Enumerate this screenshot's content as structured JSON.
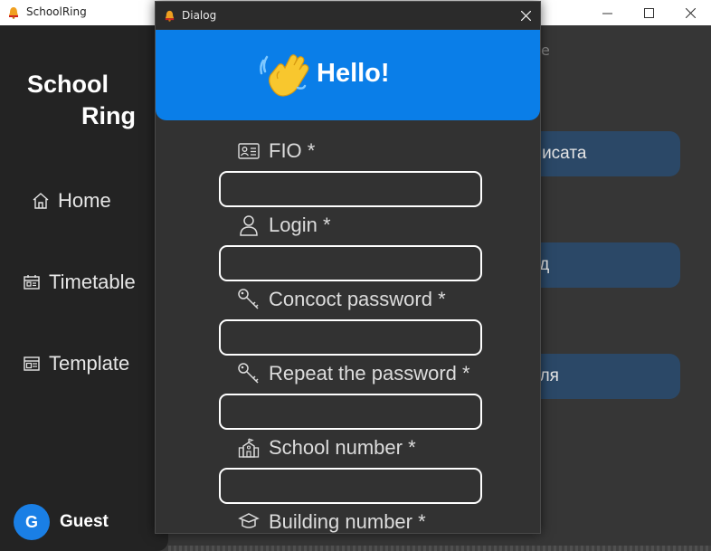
{
  "main_window": {
    "title": "SchoolRing",
    "controls": {
      "minimize": "—",
      "maximize": "☐",
      "close": "✕"
    }
  },
  "sidebar": {
    "logo_line1": "School",
    "logo_line2": "Ring",
    "nav": [
      {
        "label": "Home",
        "icon": "home-icon"
      },
      {
        "label": "Timetable",
        "icon": "calendar-icon"
      },
      {
        "label": "Template",
        "icon": "template-icon"
      }
    ],
    "user": {
      "avatar_letter": "G",
      "name": "Guest"
    }
  },
  "content": {
    "peek_text": "е",
    "cards": [
      "мисата",
      "од",
      "аля"
    ]
  },
  "dialog": {
    "title": "Dialog",
    "close": "✕",
    "banner_text": "Hello!",
    "fields": [
      {
        "label": "FIO *",
        "icon": "id-card-icon",
        "value": ""
      },
      {
        "label": "Login *",
        "icon": "user-icon",
        "value": ""
      },
      {
        "label": "Concoct password *",
        "icon": "key-icon",
        "value": ""
      },
      {
        "label": "Repeat the password *",
        "icon": "key-icon",
        "value": ""
      },
      {
        "label": "School number *",
        "icon": "school-icon",
        "value": ""
      },
      {
        "label": "Building number *",
        "icon": "building-icon",
        "value": ""
      }
    ]
  },
  "colors": {
    "accent": "#0a7ee8",
    "sidebar_bg": "#232323",
    "card_bg": "#2b4867",
    "dialog_bg": "#323232"
  }
}
